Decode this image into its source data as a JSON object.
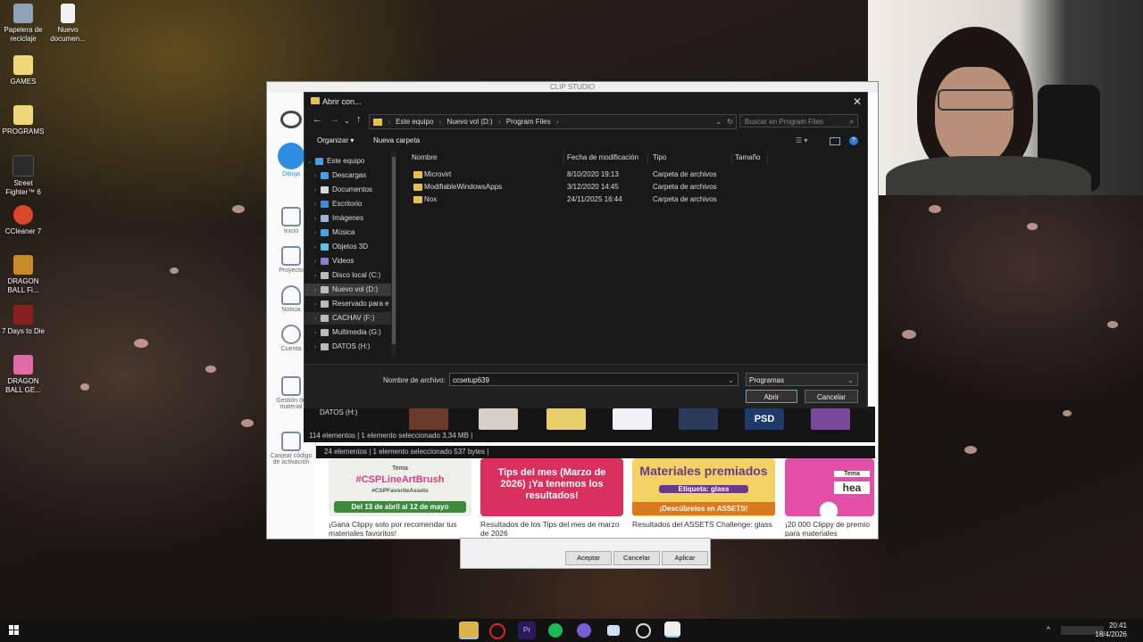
{
  "desktop": {
    "icons": [
      {
        "label": "Papelera de reciclaje",
        "icon": "recycle-bin-icon"
      },
      {
        "label": "Nuevo documen...",
        "icon": "document-icon"
      },
      {
        "label": "GAMES",
        "icon": "folder-icon"
      },
      {
        "label": "PROGRAMS",
        "icon": "folder-icon"
      },
      {
        "label": "Street Fighter™ 6",
        "icon": "game-icon"
      },
      {
        "label": "CCleaner 7",
        "icon": "ccleaner-icon"
      },
      {
        "label": "DRAGON BALL Fi...",
        "icon": "game-icon"
      },
      {
        "label": "7 Days to Die",
        "icon": "game-icon"
      },
      {
        "label": "DRAGON BALL GE...",
        "icon": "game-icon"
      }
    ]
  },
  "csp": {
    "window_title": "CLIP STUDIO",
    "sidebar": [
      {
        "label": "Dibuja",
        "icon": "brush-icon"
      },
      {
        "label": "Inicio",
        "icon": "home-icon"
      },
      {
        "label": "Proyecto",
        "icon": "project-icon"
      },
      {
        "label": "Noticia",
        "icon": "bell-icon"
      },
      {
        "label": "Cuenta",
        "icon": "user-icon"
      },
      {
        "label": "Gestión de material",
        "icon": "material-icon"
      },
      {
        "label": "Canjear código de activación",
        "icon": "code-icon"
      }
    ],
    "cards": [
      {
        "tag": "Tema",
        "title": "#CSPLineArtBrush",
        "sub": "#CSPFavoriteAssets",
        "date": "Del 13 de abril al 12 de mayo",
        "caption": "¡Gana Clippy solo por recomendar tus materiales favoritos!"
      },
      {
        "title": "Tips del mes (Marzo de 2026) ¡Ya tenemos los resultados!",
        "caption": "Resultados de los Tips del mes de marzo de 2026"
      },
      {
        "title": "Materiales premiados",
        "sub": "Etiqueta: glass",
        "date": "¡Descúbrelos en ASSETS!",
        "caption": "Resultados del ASSETS Challenge: glass"
      },
      {
        "tag": "Tema",
        "title": "hea",
        "caption": "¡20 000 Clippy de premio para materiales ganadores!"
      }
    ]
  },
  "dialog": {
    "title": "Abrir con...",
    "breadcrumb": [
      "Este equipo",
      "Nuevo vol (D:)",
      "Program Files"
    ],
    "search_placeholder": "Buscar en Program Files",
    "toolbar": {
      "organize": "Organizar",
      "new_folder": "Nueva carpeta"
    },
    "tree": [
      {
        "label": "Este equipo",
        "icon": "computer-icon",
        "color": "#4aa0e6"
      },
      {
        "label": "Descargas",
        "icon": "download-icon",
        "color": "#4aa0e6"
      },
      {
        "label": "Documentos",
        "icon": "documents-icon",
        "color": "#cfd8e3"
      },
      {
        "label": "Escritorio",
        "icon": "desktop-icon",
        "color": "#3b8fd8"
      },
      {
        "label": "Imágenes",
        "icon": "pictures-icon",
        "color": "#9ab6d6"
      },
      {
        "label": "Música",
        "icon": "music-icon",
        "color": "#4aa0e6"
      },
      {
        "label": "Objetos 3D",
        "icon": "3d-objects-icon",
        "color": "#59c2e8"
      },
      {
        "label": "Videos",
        "icon": "videos-icon",
        "color": "#8a7fd0"
      },
      {
        "label": "Disco local (C:)",
        "icon": "drive-icon",
        "color": "#bbbbbb"
      },
      {
        "label": "Nuevo vol (D:)",
        "icon": "drive-icon",
        "color": "#bbbbbb"
      },
      {
        "label": "Reservado para e",
        "icon": "drive-icon",
        "color": "#bbbbbb"
      },
      {
        "label": "CACHAV (F:)",
        "icon": "drive-icon",
        "color": "#bbbbbb"
      },
      {
        "label": "Multimedia (G:)",
        "icon": "drive-icon",
        "color": "#bbbbbb"
      },
      {
        "label": "DATOS (H:)",
        "icon": "drive-icon",
        "color": "#bbbbbb"
      }
    ],
    "columns": [
      "Nombre",
      "Fecha de modificación",
      "Tipo",
      "Tamaño"
    ],
    "files": [
      {
        "name": "Microvirt",
        "date": "8/10/2020 19:13",
        "type": "Carpeta de archivos"
      },
      {
        "name": "ModifiableWindowsApps",
        "date": "3/12/2020 14:45",
        "type": "Carpeta de archivos"
      },
      {
        "name": "Nox",
        "date": "24/11/2025 16:44",
        "type": "Carpeta de archivos"
      }
    ],
    "filename_label": "Nombre de archivo:",
    "filename_value": "ccsetup639",
    "filetype_value": "Programas",
    "open_button": "Abrir",
    "cancel_button": "Cancelar"
  },
  "background_explorer": {
    "drive_label": "DATOS (H:)",
    "status1": "114 elementos  |  1 elemento seleccionado  3,34 MB  |",
    "status2": "24 elementos  |  1 elemento seleccionado  537 bytes  |",
    "psd_label": "PSD"
  },
  "props_dialog": {
    "ok": "Aceptar",
    "cancel": "Cancelar",
    "apply": "Aplicar"
  },
  "taskbar": {
    "apps": [
      "file-explorer-icon",
      "opera-icon",
      "premiere-icon",
      "spotify-icon",
      "discord-icon",
      "window-icon",
      "chrome-like-icon",
      "clip-studio-icon"
    ],
    "time": "20:41",
    "date": "18/4/2026"
  },
  "colors": {
    "accent": "#5a9de0",
    "folder": "#e8c050",
    "dialog_bg": "#191919"
  }
}
